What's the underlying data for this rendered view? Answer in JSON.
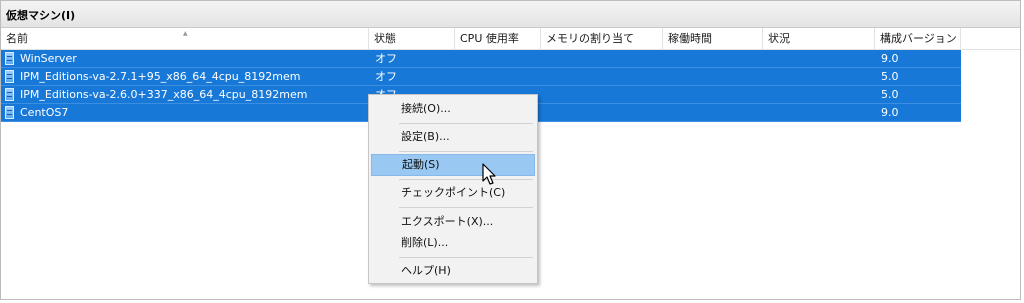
{
  "panel": {
    "title": "仮想マシン(I)"
  },
  "columns": [
    "名前",
    "状態",
    "CPU 使用率",
    "メモリの割り当て",
    "稼働時間",
    "状況",
    "構成バージョン"
  ],
  "vms": [
    {
      "name": "WinServer",
      "state": "オフ",
      "cpu": "",
      "memory": "",
      "uptime": "",
      "status": "",
      "config_version": "9.0"
    },
    {
      "name": "IPM_Editions-va-2.7.1+95_x86_64_4cpu_8192mem",
      "state": "オフ",
      "cpu": "",
      "memory": "",
      "uptime": "",
      "status": "",
      "config_version": "5.0"
    },
    {
      "name": "IPM_Editions-va-2.6.0+337_x86_64_4cpu_8192mem",
      "state": "オフ",
      "cpu": "",
      "memory": "",
      "uptime": "",
      "status": "",
      "config_version": "5.0"
    },
    {
      "name": "CentOS7",
      "state": "",
      "cpu": "",
      "memory": "",
      "uptime": "",
      "status": "",
      "config_version": "9.0"
    }
  ],
  "colors": {
    "selection": "#1778d8",
    "menu_hover": "#99c9f3",
    "menu_bg": "#f2f2f2"
  },
  "context_menu": {
    "items": [
      {
        "label": "接続(O)...",
        "icon": "connect-icon"
      },
      {
        "label": "設定(B)...",
        "icon": "settings-icon"
      },
      {
        "label": "起動(S)",
        "icon": "start-icon",
        "highlighted": true
      },
      {
        "label": "チェックポイント(C)",
        "icon": "checkpoint-icon"
      },
      {
        "label": "エクスポート(X)...",
        "icon": "export-icon"
      },
      {
        "label": "削除(L)...",
        "icon": "delete-icon"
      },
      {
        "label": "ヘルプ(H)",
        "icon": "help-icon"
      }
    ]
  }
}
